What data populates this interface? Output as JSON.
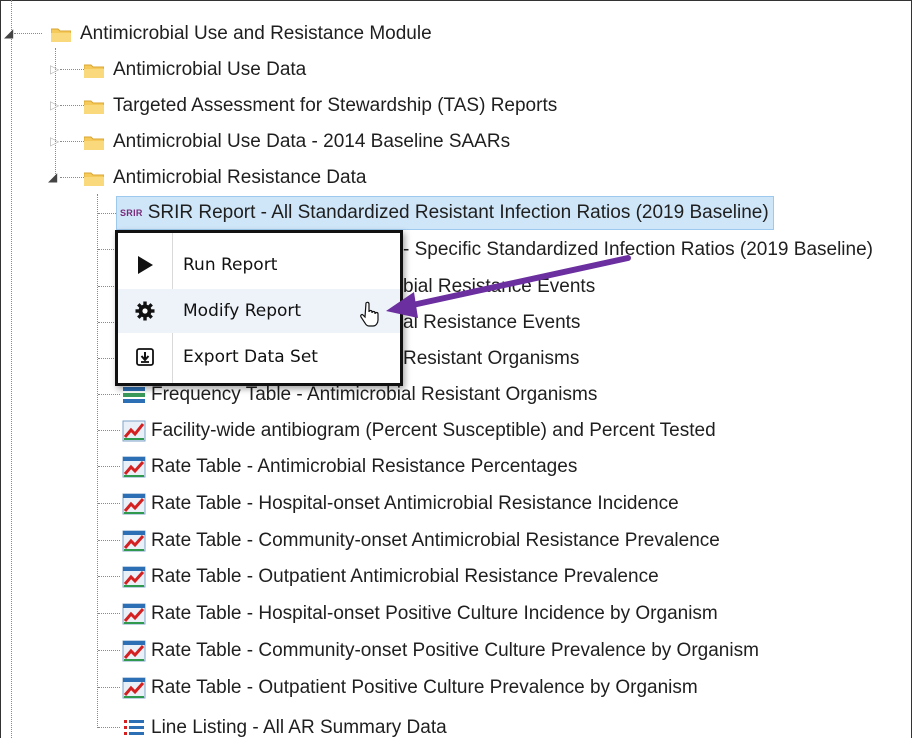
{
  "tree": {
    "root": {
      "label": "Antimicrobial Use and Resistance Module",
      "expanded": true
    },
    "folders": [
      {
        "label": "Antimicrobial Use Data",
        "expanded": false
      },
      {
        "label": "Targeted Assessment for Stewardship (TAS) Reports",
        "expanded": false
      },
      {
        "label": "Antimicrobial Use Data - 2014 Baseline SAARs",
        "expanded": false
      },
      {
        "label": "Antimicrobial Resistance Data",
        "expanded": true
      }
    ],
    "selected_badge": "SRIR",
    "reports": [
      {
        "label": "SRIR Report - All Standardized Resistant Infection Ratios (2019 Baseline)",
        "icon": "srir-icon"
      },
      {
        "label": "- Specific Standardized Infection Ratios (2019 Baseline)",
        "icon": "report-icon"
      },
      {
        "label": "bial Resistance Events",
        "icon": "report-icon"
      },
      {
        "label": "al Resistance Events",
        "icon": "report-icon"
      },
      {
        "label": "Resistant Organisms",
        "icon": "report-icon"
      },
      {
        "label": "Frequency Table - Antimicrobial Resistant Organisms",
        "icon": "frequency-table-icon"
      },
      {
        "label": "Facility-wide antibiogram (Percent Susceptible) and Percent Tested",
        "icon": "rate-chart-icon"
      },
      {
        "label": "Rate Table - Antimicrobial Resistance Percentages",
        "icon": "rate-table-icon"
      },
      {
        "label": "Rate Table - Hospital-onset Antimicrobial Resistance Incidence",
        "icon": "rate-table-icon"
      },
      {
        "label": "Rate Table - Community-onset Antimicrobial Resistance Prevalence",
        "icon": "rate-table-icon"
      },
      {
        "label": "Rate Table - Outpatient Antimicrobial Resistance Prevalence",
        "icon": "rate-table-icon"
      },
      {
        "label": "Rate Table - Hospital-onset Positive Culture Incidence by Organism",
        "icon": "rate-table-icon"
      },
      {
        "label": "Rate Table - Community-onset Positive Culture Prevalence by Organism",
        "icon": "rate-table-icon"
      },
      {
        "label": "Rate Table - Outpatient Positive Culture Prevalence by Organism",
        "icon": "rate-table-icon"
      },
      {
        "label": "Line Listing - All AR Summary Data",
        "icon": "line-listing-icon"
      }
    ]
  },
  "context_menu": {
    "items": [
      {
        "label": "Run Report",
        "icon": "play-icon"
      },
      {
        "label": "Modify Report",
        "icon": "gear-icon"
      },
      {
        "label": "Export Data Set",
        "icon": "export-icon"
      }
    ],
    "hovered": "Modify Report"
  },
  "colors": {
    "selection": "#cfe6f8",
    "folder": "#f5c95a",
    "annotation_arrow": "#6b2fa0",
    "srir_badge": "#7a2a7a"
  }
}
